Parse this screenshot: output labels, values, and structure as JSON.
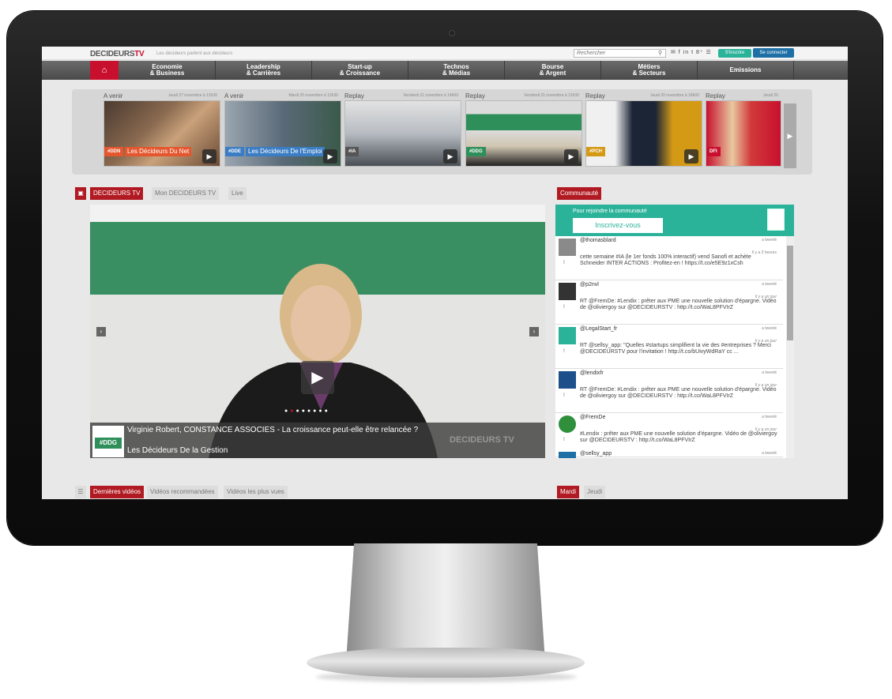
{
  "site": {
    "logo_text": "DECIDEURS",
    "logo_tv": "TV",
    "tagline": "Les décideurs parlent aux décideurs",
    "search_placeholder": "Rechercher",
    "social_icons": "✉ f in t 8⁺ ☰",
    "signup_label": "S'inscrire",
    "login_label": "Se connecter"
  },
  "nav": {
    "home_icon": "home-icon",
    "items": [
      {
        "label": "Economie\n& Business"
      },
      {
        "label": "Leadership\n& Carrières"
      },
      {
        "label": "Start-up\n& Croissance"
      },
      {
        "label": "Technos\n& Médias"
      },
      {
        "label": "Bourse\n& Argent"
      },
      {
        "label": "Métiers\n& Secteurs"
      },
      {
        "label": "Emissions"
      }
    ]
  },
  "carousel": {
    "items": [
      {
        "status": "A venir",
        "date": "Jeudi 27 novembre à 12h30",
        "tag": "#DDN",
        "caption": "Les Décideurs Du Net",
        "color": "#e4572e"
      },
      {
        "status": "A venir",
        "date": "Mardi 25 novembre à 12h30",
        "tag": "#DDE",
        "caption": "Les Décideurs De l'Emploi",
        "color": "#3b7dc4"
      },
      {
        "status": "Replay",
        "date": "Vendredi 21 novembre à 14h00",
        "tag": "#IA",
        "caption": "",
        "color": "#555555"
      },
      {
        "status": "Replay",
        "date": "Vendredi 21 novembre à 12h30",
        "tag": "#DDG",
        "caption": "",
        "color": "#2f8f5a"
      },
      {
        "status": "Replay",
        "date": "Jeudi 20 novembre à 18h00",
        "tag": "#PCH",
        "caption": "",
        "color": "#d49a16"
      },
      {
        "status": "Replay",
        "date": "Jeudi 20",
        "tag": "DFI",
        "caption": "",
        "color": "#c8102e"
      }
    ]
  },
  "tabs_top": {
    "active": "DECIDEURS TV",
    "mine": "Mon DECIDEURS TV",
    "live": "Live"
  },
  "video": {
    "title": "Virginie Robert, CONSTANCE ASSOCIES - La croissance peut-elle être relancée ?",
    "show": "Les Décideurs De la Gestion",
    "badge": "#DDG",
    "watermark": "DECIDEURS TV",
    "dots_total": 8,
    "dots_active": 1
  },
  "tabs_bottom": {
    "latest": "Dernières vidéos",
    "recommended": "Vidéos recommandées",
    "most_viewed": "Vidéos les plus vues"
  },
  "community": {
    "tab_label": "Communauté",
    "join_text": "Pour rejoindre la communauté",
    "join_button": "Inscrivez-vous",
    "tweets": [
      {
        "user": "@thomasblard",
        "label": "a tweeté",
        "time": "Il y a 3 heures",
        "text": "cette semaine #IA (le 1er fonds 100% interactif) vend Sanofi et achète Schneider INTER ACTIONS : Profitez-en ! https://t.co/e5E9z1xCsh"
      },
      {
        "user": "@p2nvl",
        "label": "a tweeté",
        "time": "Il y a un jour",
        "text": "RT @FremDe: #Lendix : prêter aux PME une nouvelle solution d'épargne. Vidéo de @oliviergoy sur @DECIDEURSTV : http://t.co/WaL8PFVIrZ"
      },
      {
        "user": "@LegalStart_fr",
        "label": "a tweeté",
        "time": "Il y a un jour",
        "text": "RT @sellsy_app: \"Quelles #startups simplifient la vie des #entreprises ? Merci @DECIDEURSTV pour l'invitation ! http://t.co/bUivyWdRaY cc ..."
      },
      {
        "user": "@lendixfr",
        "label": "a tweeté",
        "time": "Il y a un jour",
        "text": "RT @FremDe: #Lendix : prêter aux PME une nouvelle solution d'épargne. Vidéo de @oliviergoy sur @DECIDEURSTV : http://t.co/WaL8PFVIrZ"
      },
      {
        "user": "@FremDe",
        "label": "a tweeté",
        "time": "Il y a un jour",
        "text": "#Lendix : prêter aux PME une nouvelle solution d'épargne. Vidéo de @oliviergoy sur @DECIDEURSTV : http://t.co/WaL8PFVIrZ"
      },
      {
        "user": "@sellsy_app",
        "label": "a tweeté",
        "time": "",
        "text": ""
      }
    ]
  },
  "days": {
    "first": "Mardi",
    "second": "Jeudi"
  },
  "colors": {
    "accent_red": "#b11a22",
    "community_green": "#2bb39a",
    "login_blue": "#1d6fa5"
  }
}
